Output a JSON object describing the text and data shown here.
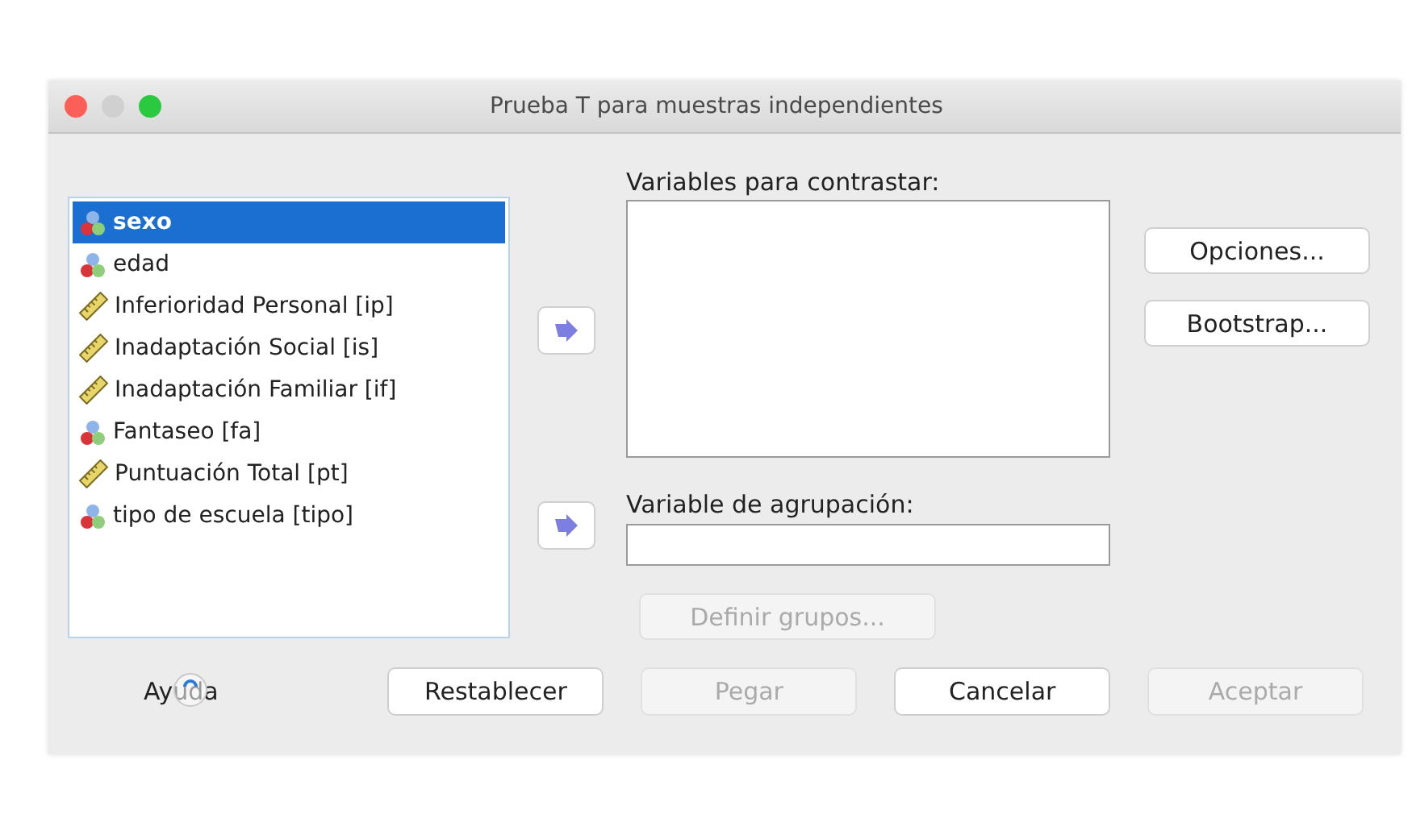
{
  "window": {
    "title": "Prueba T para muestras independientes"
  },
  "variables": [
    {
      "name": "sexo",
      "kind": "nominal",
      "selected": true
    },
    {
      "name": "edad",
      "kind": "nominal",
      "selected": false
    },
    {
      "name": "Inferioridad Personal [ip]",
      "kind": "scale",
      "selected": false
    },
    {
      "name": "Inadaptación Social [is]",
      "kind": "scale",
      "selected": false
    },
    {
      "name": "Inadaptación Familiar [if]",
      "kind": "scale",
      "selected": false
    },
    {
      "name": "Fantaseo [fa]",
      "kind": "nominal",
      "selected": false
    },
    {
      "name": "Puntuación Total [pt]",
      "kind": "scale",
      "selected": false
    },
    {
      "name": "tipo de escuela [tipo]",
      "kind": "nominal",
      "selected": false
    }
  ],
  "test_variables": {
    "label": "Variables para contrastar:"
  },
  "grouping_variable": {
    "label": "Variable de agrupación:"
  },
  "define_groups": {
    "label": "Definir grupos...",
    "disabled": true
  },
  "side_buttons": [
    {
      "label": "Opciones...",
      "disabled": false
    },
    {
      "label": "Bootstrap...",
      "disabled": false
    }
  ],
  "footer_buttons": [
    {
      "label": "Ayuda",
      "kind": "help",
      "disabled": false
    },
    {
      "label": "Restablecer",
      "kind": "push",
      "disabled": false
    },
    {
      "label": "Pegar",
      "kind": "push",
      "disabled": true
    },
    {
      "label": "Cancelar",
      "kind": "push",
      "disabled": false
    },
    {
      "label": "Aceptar",
      "kind": "push",
      "disabled": true
    }
  ]
}
